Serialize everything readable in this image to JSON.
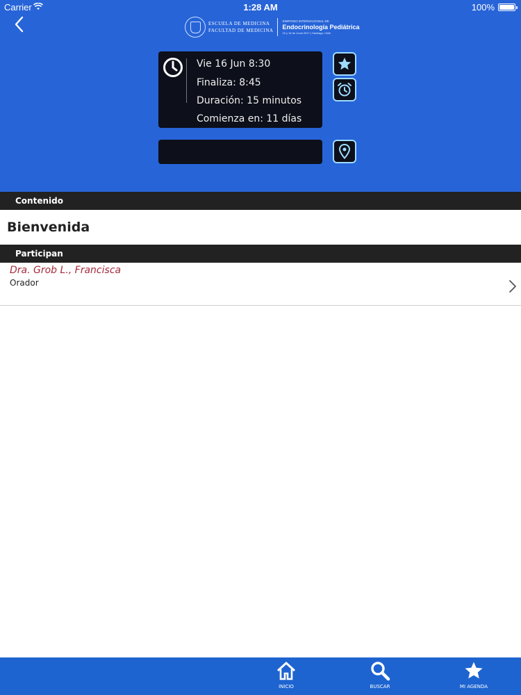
{
  "status_bar": {
    "carrier": "Carrier",
    "time": "1:28 AM",
    "battery": "100%"
  },
  "header": {
    "logo": {
      "school_line1": "ESCUELA DE MEDICINA",
      "school_line2": "FACULTAD DE MEDICINA",
      "event_small": "SIMPOSIO INTERNACIONAL DE",
      "event_big_1": "Endocrinología Pediátrica",
      "event_tiny": "15 y 16 de Junio 2017 | Santiago, Chile"
    }
  },
  "session": {
    "date": "Vie 16  Jun  8:30",
    "end": "Finaliza: 8:45",
    "duration": "Duración: 15 minutos",
    "starts_in": "Comienza en: 11 días",
    "location": ""
  },
  "sections": {
    "content_header": "Contenido",
    "title": "Bienvenida",
    "participants_header": "Participan"
  },
  "participants": [
    {
      "name": "Dra. Grob L., Francisca",
      "role": "Orador"
    }
  ],
  "tabbar": {
    "home": "INICIO",
    "search": "BUSCAR",
    "agenda": "MI AGENDA"
  },
  "colors": {
    "header_blue": "#2764d8",
    "card_dark": "#0d0f1a",
    "accent_cyan": "#9fdcff",
    "participant_name": "#a52a3c",
    "tabbar_blue": "#1d64d0"
  }
}
